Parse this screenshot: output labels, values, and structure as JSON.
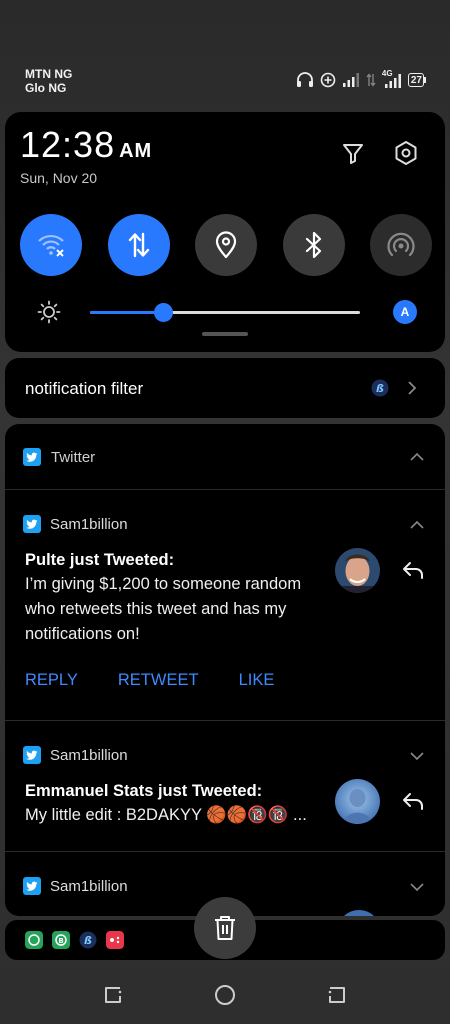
{
  "status_bar": {
    "carrier_1": "MTN NG",
    "carrier_2": "Glo NG",
    "network_type": "4G",
    "battery": "27",
    "icons": [
      "headphones-icon",
      "data-saver-icon",
      "signal-icon",
      "signal-icon",
      "battery-icon"
    ]
  },
  "quick_settings": {
    "time": "12:38",
    "ampm": "AM",
    "date": "Sun, Nov 20",
    "top_icons": [
      "filter-icon",
      "settings-icon"
    ],
    "tiles": [
      {
        "name": "wifi",
        "icon": "wifi-off-icon",
        "state": "on"
      },
      {
        "name": "mobile-data",
        "icon": "data-arrows-icon",
        "state": "on"
      },
      {
        "name": "location",
        "icon": "location-pin-icon",
        "state": "off"
      },
      {
        "name": "bluetooth",
        "icon": "bluetooth-icon",
        "state": "off"
      },
      {
        "name": "hotspot",
        "icon": "hotspot-icon",
        "state": "dim"
      }
    ],
    "brightness_level": 0.27,
    "auto_brightness_label": "A"
  },
  "notification_filter": {
    "label": "notification filter"
  },
  "notifications": {
    "group_title": "Twitter",
    "items": [
      {
        "app": "Sam1billion",
        "title": "Pulte just Tweeted:",
        "body": "I’m giving $1,200 to someone random who retweets this tweet and has my notifications on!",
        "actions": [
          "REPLY",
          "RETWEET",
          "LIKE"
        ],
        "expanded": true
      },
      {
        "app": "Sam1billion",
        "title": "Emmanuel Stats just Tweeted:",
        "body": "My little edit : B2DAKYY 🏀🏀🔞🔞 ...",
        "expanded": false
      },
      {
        "app": "Sam1billion",
        "expanded": false
      }
    ]
  },
  "colors": {
    "accent": "#2979ff",
    "action_text": "#3d8bff",
    "twitter": "#1da1f2"
  }
}
